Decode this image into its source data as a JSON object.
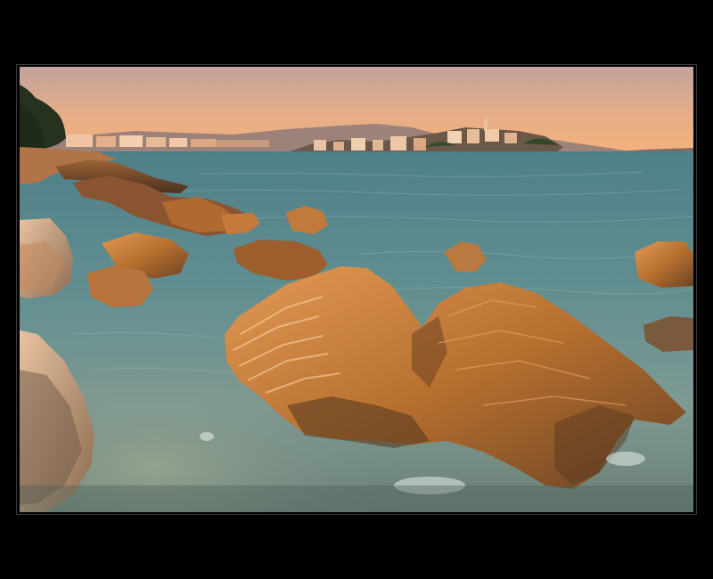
{
  "photo": {
    "subject": "coastal-sunset-rocks",
    "palette": {
      "mat": "#000000",
      "sky_top": "#c8a7a0",
      "sky_bottom": "#f2b07e",
      "sea_far": "#5e8a8f",
      "sea_near": "#7da0a0",
      "rock_lit": "#c57a38",
      "rock_shadow": "#5a3a22",
      "town": "#e8c2a0",
      "trees": "#2d3b22"
    }
  }
}
